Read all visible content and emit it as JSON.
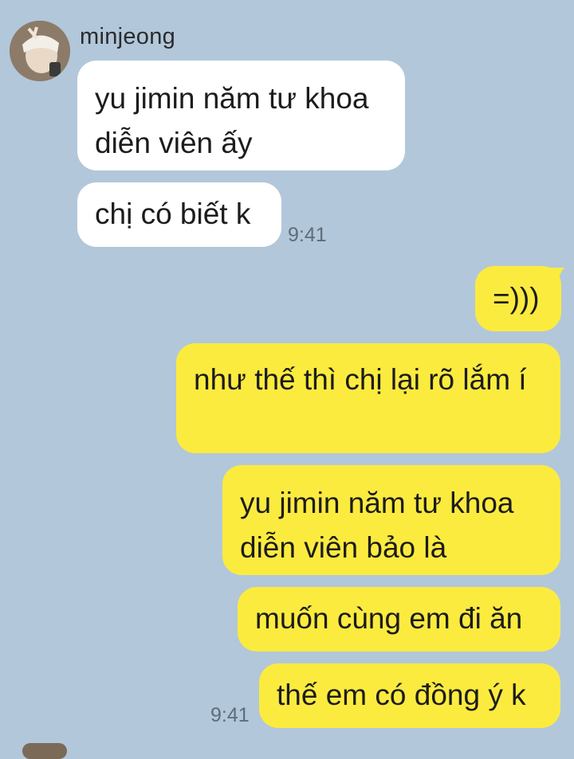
{
  "chat": {
    "sender_name": "minjeong",
    "incoming": [
      {
        "text": "yu jimin năm tư khoa diễn viên ấy"
      },
      {
        "text": "chị có biết k"
      }
    ],
    "incoming_time": "9:41",
    "outgoing": [
      {
        "text": "=)))"
      },
      {
        "text": "như thế thì chị lại rõ lắm í"
      },
      {
        "text": "yu jimin năm tư khoa diễn viên bảo là"
      },
      {
        "text": "muốn cùng em đi ăn"
      },
      {
        "text": "thế em có đồng ý k"
      }
    ],
    "outgoing_time": "9:41"
  },
  "colors": {
    "background": "#b2c7da",
    "incoming_bubble": "#ffffff",
    "outgoing_bubble": "#fceb3f",
    "timestamp": "#5f6c78"
  },
  "icons": {
    "avatar": "profile-photo"
  }
}
